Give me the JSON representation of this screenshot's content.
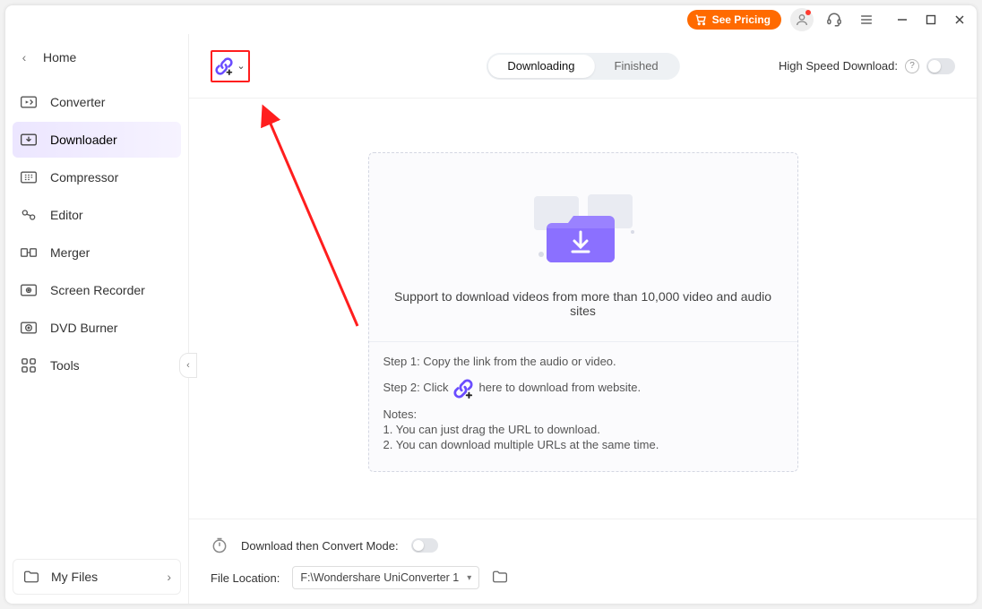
{
  "titlebar": {
    "pricing_label": "See Pricing"
  },
  "sidebar": {
    "home_label": "Home",
    "items": [
      {
        "label": "Converter"
      },
      {
        "label": "Downloader"
      },
      {
        "label": "Compressor"
      },
      {
        "label": "Editor"
      },
      {
        "label": "Merger"
      },
      {
        "label": "Screen Recorder"
      },
      {
        "label": "DVD Burner"
      },
      {
        "label": "Tools"
      }
    ],
    "my_files_label": "My Files"
  },
  "toolbar": {
    "tabs": {
      "downloading": "Downloading",
      "finished": "Finished"
    },
    "high_speed_label": "High Speed Download:"
  },
  "empty": {
    "support_text": "Support to download videos from more than 10,000 video and audio sites",
    "step1": "Step 1: Copy the link from the audio or video.",
    "step2_a": "Step 2: Click",
    "step2_b": "here to download from website.",
    "notes_title": "Notes:",
    "note1": "1. You can just drag the URL to download.",
    "note2": "2. You can download multiple URLs at the same time."
  },
  "footer": {
    "convert_mode_label": "Download then Convert Mode:",
    "file_location_label": "File Location:",
    "file_location_value": "F:\\Wondershare UniConverter 1"
  }
}
